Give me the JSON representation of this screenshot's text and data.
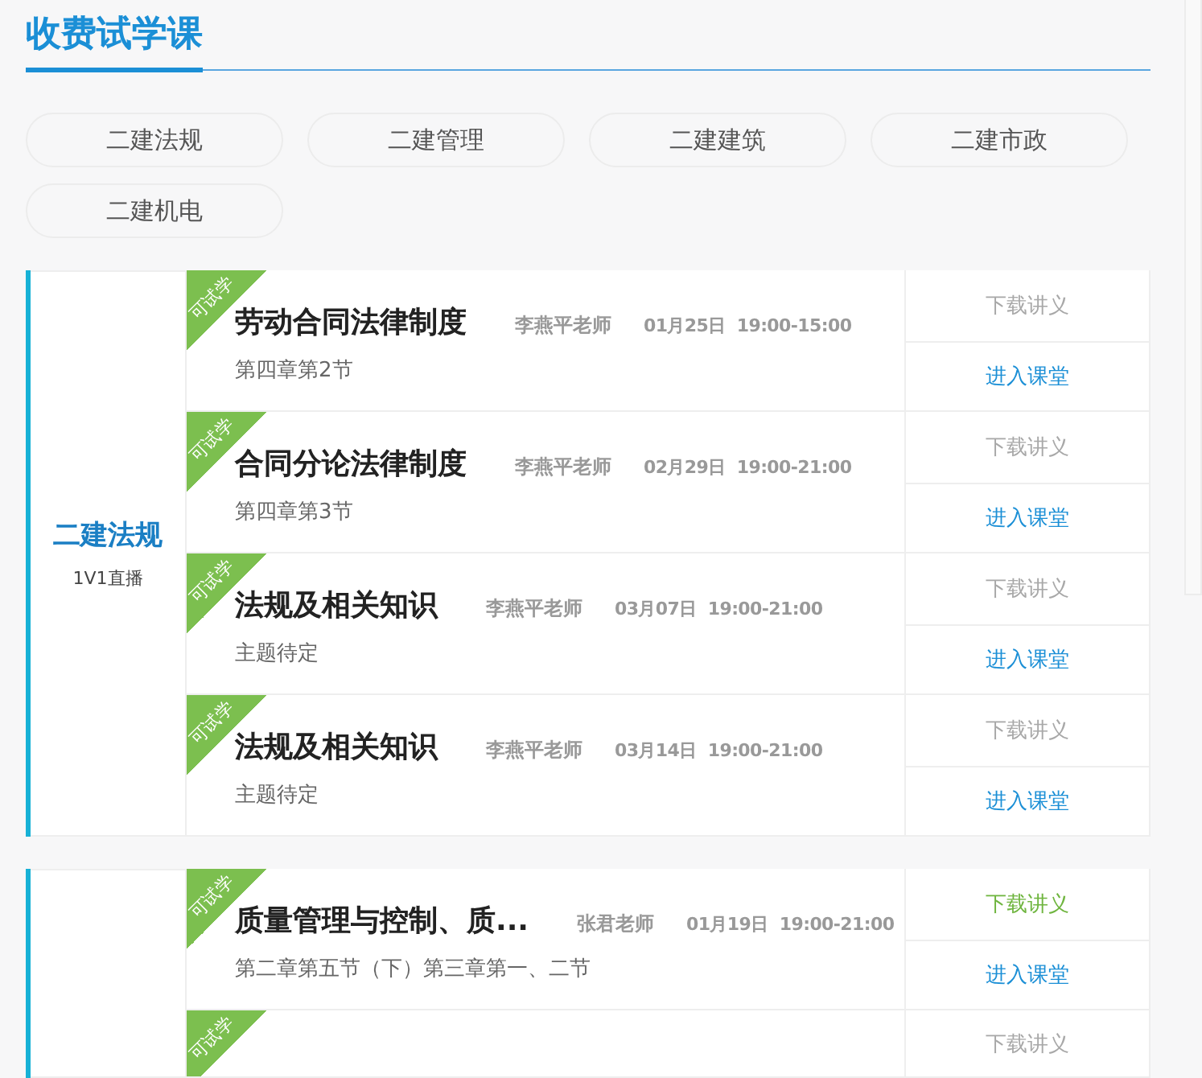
{
  "heading": "收费试学课",
  "tabs": [
    {
      "label": "二建法规",
      "selected": false
    },
    {
      "label": "二建管理",
      "selected": false
    },
    {
      "label": "二建建筑",
      "selected": false
    },
    {
      "label": "二建市政",
      "selected": false
    },
    {
      "label": "二建机电",
      "selected": false
    }
  ],
  "groups": [
    {
      "subject": "二建法规",
      "mode": "1V1直播",
      "lessons": [
        {
          "ribbon": "可试学",
          "title": "劳动合同法律制度",
          "teacher": "李燕平老师",
          "time": "01月25日  19:00-15:00",
          "chapter": "第四章第2节",
          "download": {
            "label": "下载讲义",
            "disabled": true
          },
          "enter": "进入课堂"
        },
        {
          "ribbon": "可试学",
          "title": "合同分论法律制度",
          "teacher": "李燕平老师",
          "time": "02月29日  19:00-21:00",
          "chapter": "第四章第3节",
          "download": {
            "label": "下载讲义",
            "disabled": true
          },
          "enter": "进入课堂"
        },
        {
          "ribbon": "可试学",
          "title": "法规及相关知识",
          "teacher": "李燕平老师",
          "time": "03月07日  19:00-21:00",
          "chapter": "主题待定",
          "download": {
            "label": "下载讲义",
            "disabled": true
          },
          "enter": "进入课堂"
        },
        {
          "ribbon": "可试学",
          "title": "法规及相关知识",
          "teacher": "李燕平老师",
          "time": "03月14日  19:00-21:00",
          "chapter": "主题待定",
          "download": {
            "label": "下载讲义",
            "disabled": true
          },
          "enter": "进入课堂"
        }
      ]
    },
    {
      "lessons": [
        {
          "ribbon": "可试学",
          "title": "质量管理与控制、质...",
          "teacher": "张君老师",
          "time": "01月19日  19:00-21:00",
          "chapter": "第二章第五节（下）第三章第一、二节",
          "download": {
            "label": "下载讲义",
            "disabled": false
          },
          "enter": "进入课堂"
        },
        {
          "ribbon": "可试学",
          "download": {
            "label": "下载讲义",
            "disabled": true
          }
        }
      ]
    }
  ]
}
